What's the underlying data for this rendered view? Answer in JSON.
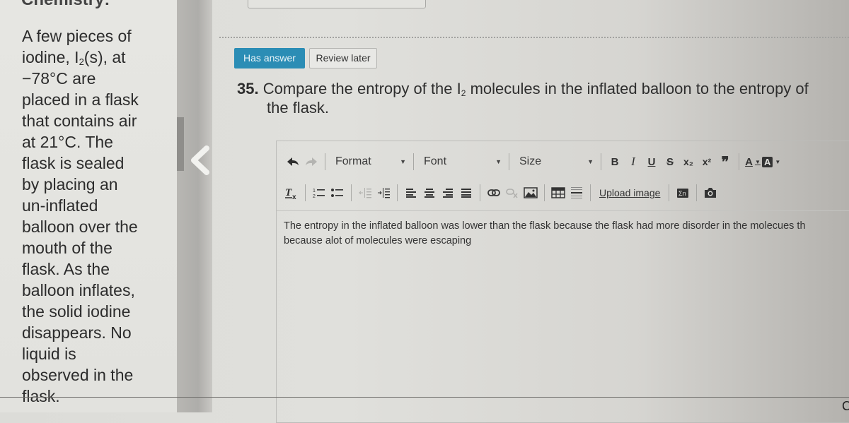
{
  "left_panel": {
    "heading_fragment": "Chemistry:",
    "passage_lines": [
      "A few pieces of",
      "iodine, I",
      "−78°C are",
      "placed in a flask",
      "that contains air",
      "at 21°C. The",
      "flask is sealed",
      "by placing an",
      "un-inflated",
      "balloon over the",
      "mouth of the",
      "flask. As the",
      "balloon inflates,",
      "the solid iodine",
      "disappears. No",
      "liquid is",
      "observed in the",
      "flask."
    ],
    "iodine_subscript": "2",
    "iodine_suffix": "(s), at"
  },
  "collapse_button": {
    "icon": "chevron-left-icon"
  },
  "status_buttons": {
    "has_answer": "Has answer",
    "review_later": "Review later"
  },
  "question": {
    "number": "35.",
    "text_before_sub": " Compare the entropy of the I",
    "subscript": "2",
    "text_after_sub": " molecules in the inflated balloon to the entropy of",
    "line2": "the flask."
  },
  "editor": {
    "toolbar": {
      "undo_icon": "undo-icon",
      "redo_icon": "redo-icon",
      "format_label": "Format",
      "font_label": "Font",
      "size_label": "Size",
      "bold": "B",
      "italic": "I",
      "underline": "U",
      "strike": "S",
      "subscript": "x₂",
      "superscript": "x²",
      "blockquote": "❞",
      "text_color": "A",
      "bg_color": "A",
      "upload_image": "Upload image"
    },
    "content": {
      "line1": "The entropy in the inflated balloon was lower than the flask because the flask had more disorder in the molecues th",
      "line2": "because alot of molecules were escaping"
    }
  },
  "corner_char": "C",
  "colors": {
    "has_answer_bg": "#2b8db5",
    "review_bg": "#e8e8e5",
    "text": "#2e2e2e"
  }
}
